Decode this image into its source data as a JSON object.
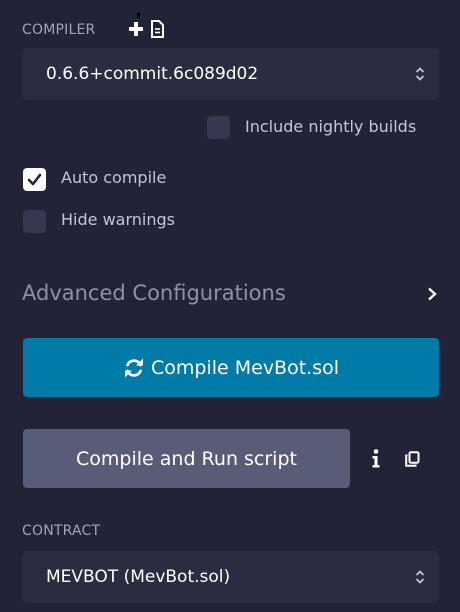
{
  "compiler": {
    "section_label": "COMPILER",
    "add_icon": "plus-icon",
    "file_icon": "file-icon",
    "version_value": "0.6.6+commit.6c089d02"
  },
  "options": {
    "nightly_label": "Include nightly builds",
    "nightly_checked": false,
    "auto_compile_label": "Auto compile",
    "auto_compile_checked": true,
    "hide_warnings_label": "Hide warnings",
    "hide_warnings_checked": false
  },
  "advanced": {
    "label": "Advanced Configurations",
    "expand_icon": "chevron-right-icon"
  },
  "buttons": {
    "compile_label": "Compile MevBot.sol",
    "compile_icon": "refresh-icon",
    "run_label": "Compile and Run script",
    "info_icon": "info-icon",
    "copy_icon": "copy-icon"
  },
  "contract": {
    "section_label": "CONTRACT",
    "value": "MEVBOT (MevBot.sol)"
  },
  "colors": {
    "background": "#222336",
    "input_background": "#2a2c3f",
    "primary_button": "#007aa6",
    "secondary_button": "#595c76",
    "muted_text": "#a2a3bd"
  }
}
